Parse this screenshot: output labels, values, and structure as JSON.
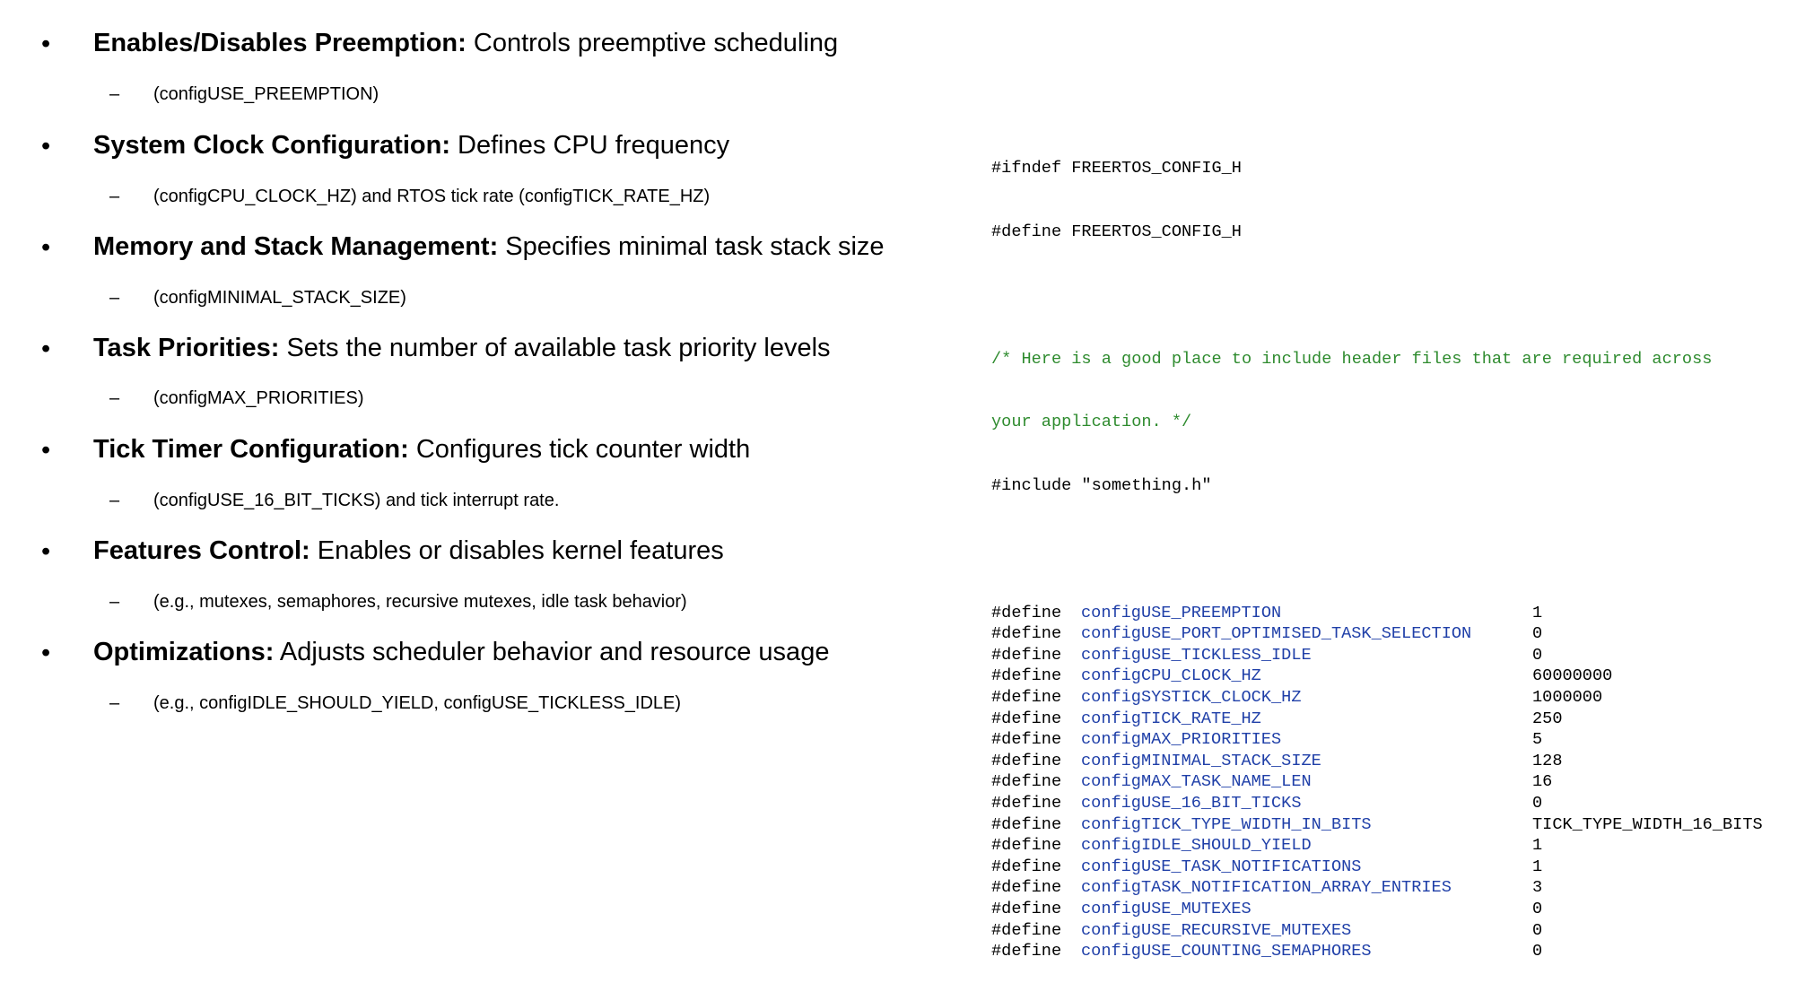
{
  "bullets": [
    {
      "heading": "Enables/Disables Preemption:",
      "description": " Controls preemptive scheduling",
      "detail": "(configUSE_PREEMPTION)"
    },
    {
      "heading": "System Clock Configuration:",
      "description": " Defines CPU frequency",
      "detail": "(configCPU_CLOCK_HZ) and RTOS tick rate (configTICK_RATE_HZ)"
    },
    {
      "heading": "Memory and Stack Management:",
      "description": " Specifies minimal task stack size",
      "detail": "(configMINIMAL_STACK_SIZE)"
    },
    {
      "heading": "Task Priorities:",
      "description": " Sets the number of available task priority levels",
      "detail": "(configMAX_PRIORITIES)"
    },
    {
      "heading": "Tick Timer Configuration:",
      "description": " Configures tick counter width",
      "detail": "(configUSE_16_BIT_TICKS) and tick interrupt rate."
    },
    {
      "heading": "Features Control:",
      "description": " Enables or disables kernel features",
      "detail": "(e.g., mutexes, semaphores, recursive mutexes, idle task behavior)"
    },
    {
      "heading": "Optimizations:",
      "description": " Adjusts scheduler behavior and resource usage",
      "detail": "(e.g., configIDLE_SHOULD_YIELD, configUSE_TICKLESS_IDLE)"
    }
  ],
  "bullet_symbol": "•",
  "dash_symbol": "–",
  "code": {
    "header_lines": [
      "#ifndef FREERTOS_CONFIG_H",
      "#define FREERTOS_CONFIG_H"
    ],
    "comment_lines": [
      "/* Here is a good place to include header files that are required across",
      "your application. */"
    ],
    "include_line": "#include \"something.h\"",
    "define_keyword": "#define",
    "defines": [
      {
        "name": "configUSE_PREEMPTION",
        "value": "1"
      },
      {
        "name": "configUSE_PORT_OPTIMISED_TASK_SELECTION",
        "value": "0"
      },
      {
        "name": "configUSE_TICKLESS_IDLE",
        "value": "0"
      },
      {
        "name": "configCPU_CLOCK_HZ",
        "value": "60000000"
      },
      {
        "name": "configSYSTICK_CLOCK_HZ",
        "value": "1000000"
      },
      {
        "name": "configTICK_RATE_HZ",
        "value": "250"
      },
      {
        "name": "configMAX_PRIORITIES",
        "value": "5"
      },
      {
        "name": "configMINIMAL_STACK_SIZE",
        "value": "128"
      },
      {
        "name": "configMAX_TASK_NAME_LEN",
        "value": "16"
      },
      {
        "name": "configUSE_16_BIT_TICKS",
        "value": "0"
      },
      {
        "name": "configTICK_TYPE_WIDTH_IN_BITS",
        "value": "TICK_TYPE_WIDTH_16_BITS"
      },
      {
        "name": "configIDLE_SHOULD_YIELD",
        "value": "1"
      },
      {
        "name": "configUSE_TASK_NOTIFICATIONS",
        "value": "1"
      },
      {
        "name": "configTASK_NOTIFICATION_ARRAY_ENTRIES",
        "value": "3"
      },
      {
        "name": "configUSE_MUTEXES",
        "value": "0"
      },
      {
        "name": "configUSE_RECURSIVE_MUTEXES",
        "value": "0"
      },
      {
        "name": "configUSE_COUNTING_SEMAPHORES",
        "value": "0"
      }
    ]
  },
  "colors": {
    "comment": "#2e8b2e",
    "macro_name": "#1f3fa8",
    "text": "#000000",
    "background": "#ffffff"
  }
}
